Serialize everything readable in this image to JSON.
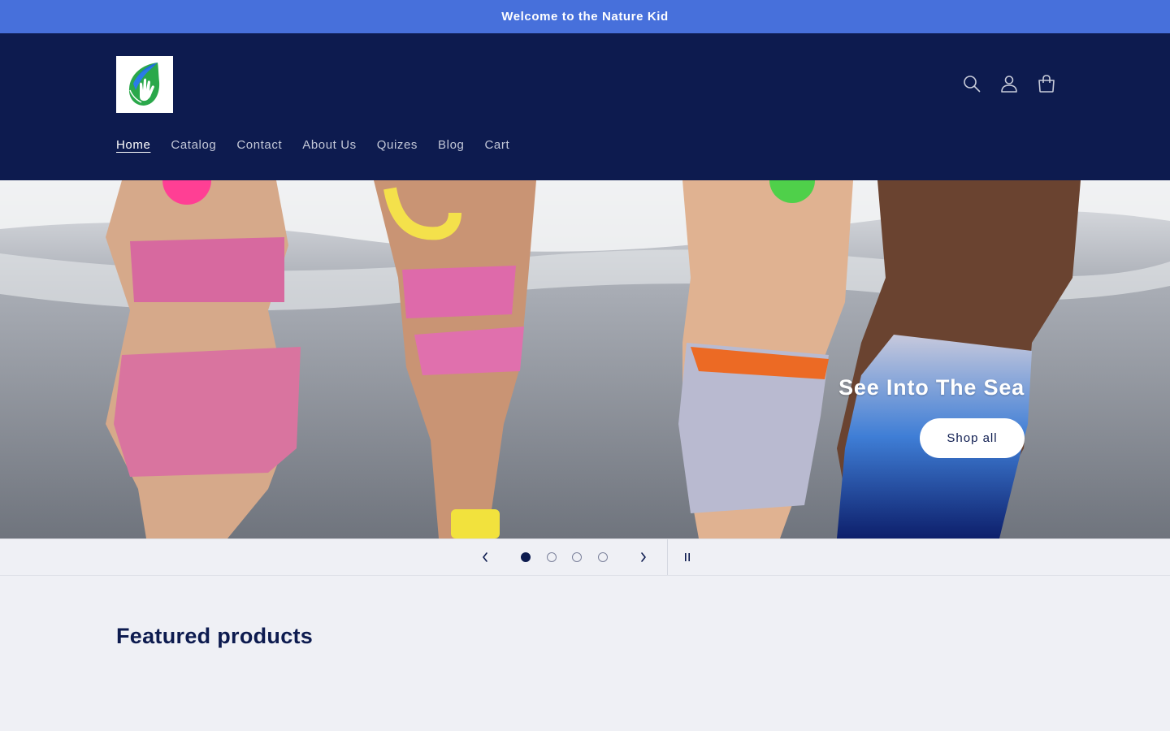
{
  "announcement": {
    "text": "Welcome to the Nature Kid"
  },
  "header": {
    "logo_icon": "leaf-hand-icon",
    "icons": [
      "search-icon",
      "account-icon",
      "cart-icon"
    ]
  },
  "nav": {
    "items": [
      {
        "label": "Home",
        "active": true
      },
      {
        "label": "Catalog"
      },
      {
        "label": "Contact"
      },
      {
        "label": "About Us"
      },
      {
        "label": "Quizes"
      },
      {
        "label": "Blog"
      },
      {
        "label": "Cart"
      }
    ]
  },
  "hero": {
    "title": "See Into The Sea",
    "button_label": "Shop all"
  },
  "slider": {
    "slide_count": 4,
    "active_slide": 1
  },
  "featured": {
    "title": "Featured products"
  },
  "colors": {
    "announcement": "#4770db",
    "header": "#0d1b4f",
    "page_background": "#eff0f5"
  }
}
